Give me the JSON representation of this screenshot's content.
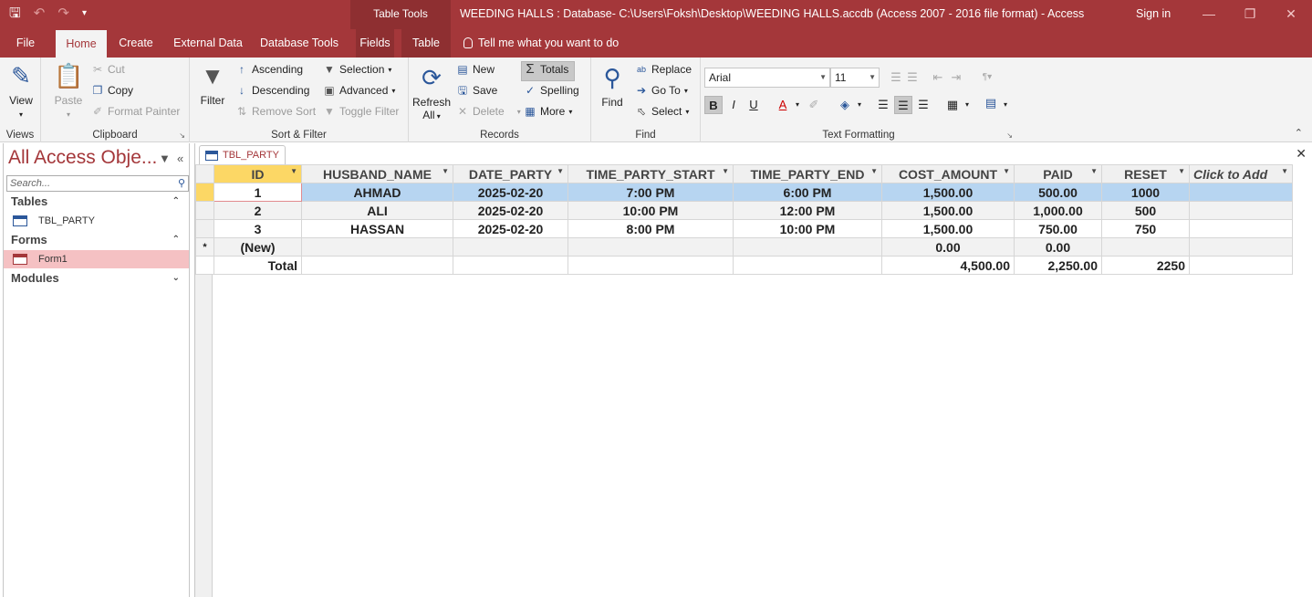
{
  "titlebar": {
    "context_tab": "Table Tools",
    "window_title": "WEEDING HALLS : Database- C:\\Users\\Foksh\\Desktop\\WEEDING HALLS.accdb (Access 2007 - 2016 file format)  -  Access",
    "sign_in": "Sign in"
  },
  "ribbon_tabs": [
    "File",
    "Home",
    "Create",
    "External Data",
    "Database Tools",
    "Fields",
    "Table"
  ],
  "tell_me": "Tell me what you want to do",
  "groups": {
    "views": {
      "label": "Views",
      "view": "View"
    },
    "clipboard": {
      "label": "Clipboard",
      "paste": "Paste",
      "cut": "Cut",
      "copy": "Copy",
      "format_painter": "Format Painter"
    },
    "sort_filter": {
      "label": "Sort & Filter",
      "filter": "Filter",
      "ascending": "Ascending",
      "descending": "Descending",
      "remove_sort": "Remove Sort",
      "selection": "Selection",
      "advanced": "Advanced",
      "toggle_filter": "Toggle Filter"
    },
    "records": {
      "label": "Records",
      "refresh_all_1": "Refresh",
      "refresh_all_2": "All",
      "new": "New",
      "save": "Save",
      "delete": "Delete",
      "totals": "Totals",
      "spelling": "Spelling",
      "more": "More"
    },
    "find": {
      "label": "Find",
      "find": "Find",
      "replace": "Replace",
      "go_to": "Go To",
      "select": "Select"
    },
    "text_formatting": {
      "label": "Text Formatting",
      "font": "Arial",
      "size": "11",
      "bold": "B",
      "italic": "I",
      "underline": "U"
    }
  },
  "nav": {
    "title": "All Access Obje...",
    "search_placeholder": "Search...",
    "tables_label": "Tables",
    "table_item": "TBL_PARTY",
    "forms_label": "Forms",
    "form_item": "Form1",
    "modules_label": "Modules"
  },
  "document": {
    "tab": "TBL_PARTY"
  },
  "table": {
    "columns": [
      "ID",
      "HUSBAND_NAME",
      "DATE_PARTY",
      "TIME_PARTY_START",
      "TIME_PARTY_END",
      "COST_AMOUNT",
      "PAID",
      "RESET",
      "Click to Add"
    ],
    "rows": [
      [
        "1",
        "AHMAD",
        "2025-02-20",
        "7:00 PM",
        "6:00 PM",
        "1,500.00",
        "500.00",
        "1000"
      ],
      [
        "2",
        "ALI",
        "2025-02-20",
        "10:00 PM",
        "12:00 PM",
        "1,500.00",
        "1,000.00",
        "500"
      ],
      [
        "3",
        "HASSAN",
        "2025-02-20",
        "8:00 PM",
        "10:00 PM",
        "1,500.00",
        "750.00",
        "750"
      ]
    ],
    "new_row": {
      "marker": "*",
      "label": "(New)",
      "cost": "0.00",
      "paid": "0.00"
    },
    "total_row": {
      "label": "Total",
      "cost": "4,500.00",
      "paid": "2,250.00",
      "reset": "2250"
    }
  },
  "colors": {
    "accent": "#a4373a",
    "selected_row": "#b7d5f1",
    "header_highlight": "#fcd765"
  }
}
